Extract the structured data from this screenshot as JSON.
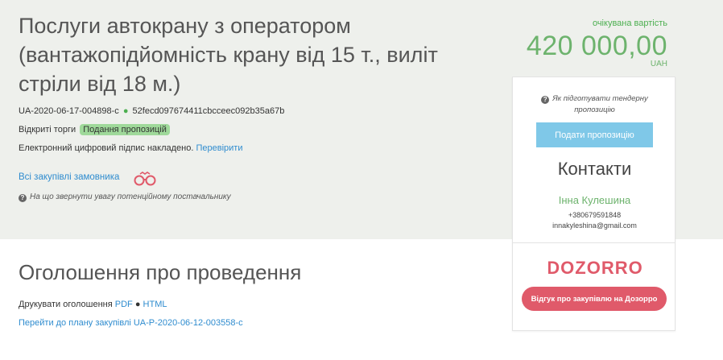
{
  "tender": {
    "title": "Послуги автокрану з оператором (вантажопідйомність крану від 15 т., виліт стріли від 18 м.)",
    "tender_id": "UA-2020-06-17-004898-c",
    "hash": "52fecd097674411cbcceec092b35a67b",
    "procedure_type": "Відкриті торги",
    "status_badge": "Подання пропозицій",
    "signature_text": "Електронний цифровий підпис накладено.",
    "verify_link": "Перевірити",
    "buyer_link": "Всі закупівлі замовника",
    "attention_note": "На що звернути увагу потенційному постачальнику"
  },
  "price": {
    "caption": "очікувана вартість",
    "value": "420 000,00",
    "currency": "UAH"
  },
  "panel": {
    "howto": "Як підготувати тендерну пропозицію",
    "submit_label": "Подати пропозицію",
    "contacts_title": "Контакти",
    "contact_name": "Інна Кулешина",
    "contact_phone": "+380679591848",
    "contact_email": "innakyleshina@gmail.com",
    "dozorro_logo_text": "DOZORRO",
    "feedback_label": "Відгук про закупівлю на Дозорро"
  },
  "announcement": {
    "title": "Оголошення про проведення",
    "print_label": "Друкувати оголошення",
    "pdf_link": "PDF",
    "html_link": "HTML",
    "plan_link": "Перейти до плану закупівлі UA-P-2020-06-12-003558-c"
  },
  "colors": {
    "band_bg": "#eef0ec",
    "green": "#6db36d",
    "link_blue": "#2f8ccf",
    "submit_blue": "#7fc8e8",
    "dozorro_red": "#e05a6a"
  }
}
